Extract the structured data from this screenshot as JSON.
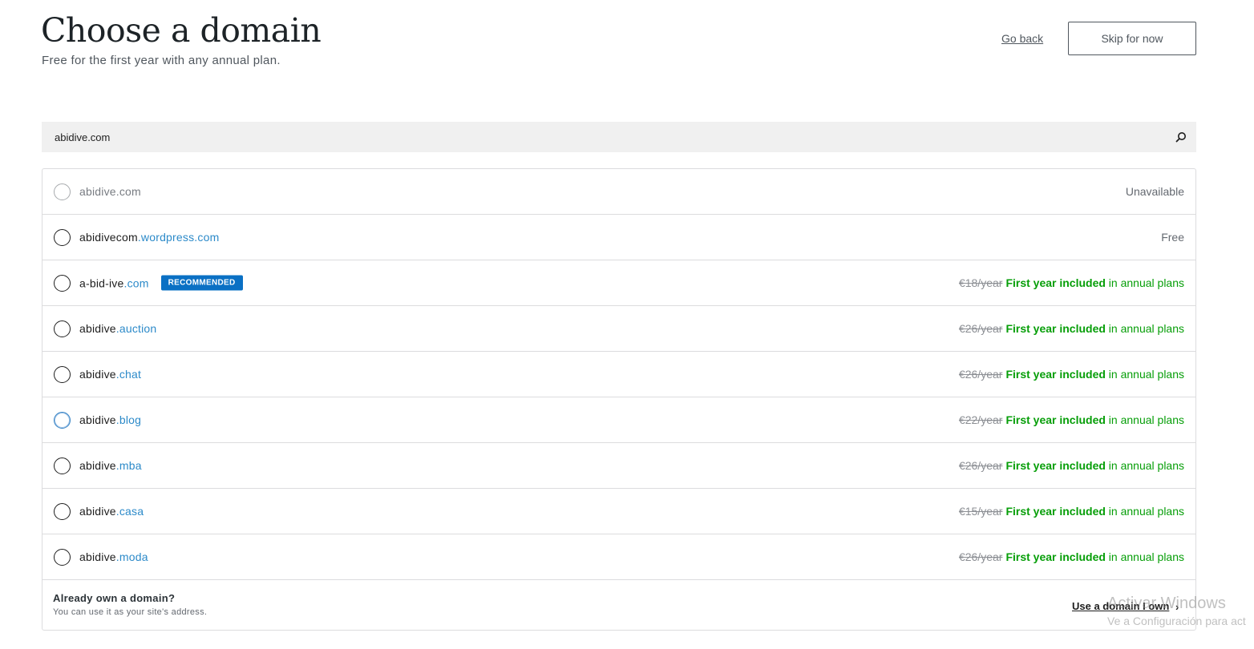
{
  "header": {
    "title": "Choose a domain",
    "subtitle": "Free for the first year with any annual plan.",
    "go_back_label": "Go back",
    "skip_label": "Skip for now"
  },
  "search": {
    "value": "abidive.com",
    "icon": "search-icon"
  },
  "domains": [
    {
      "base": "abidive.com",
      "tld": "",
      "price_text": "Unavailable",
      "state": "unavailable"
    },
    {
      "base": "abidivecom",
      "tld": ".wordpress.com",
      "price_text": "Free",
      "state": "free"
    },
    {
      "base": "a-bid-ive",
      "tld": ".com",
      "badge": "RECOMMENDED",
      "old_price": "€18/year",
      "included_bold": "First year included",
      "included_rest": " in annual plans"
    },
    {
      "base": "abidive",
      "tld": ".auction",
      "old_price": "€26/year",
      "included_bold": "First year included",
      "included_rest": " in annual plans"
    },
    {
      "base": "abidive",
      "tld": ".chat",
      "old_price": "€26/year",
      "included_bold": "First year included",
      "included_rest": " in annual plans"
    },
    {
      "base": "abidive",
      "tld": ".blog",
      "old_price": "€22/year",
      "included_bold": "First year included",
      "included_rest": " in annual plans",
      "focused": true
    },
    {
      "base": "abidive",
      "tld": ".mba",
      "old_price": "€26/year",
      "included_bold": "First year included",
      "included_rest": " in annual plans"
    },
    {
      "base": "abidive",
      "tld": ".casa",
      "old_price": "€15/year",
      "included_bold": "First year included",
      "included_rest": " in annual plans"
    },
    {
      "base": "abidive",
      "tld": ".moda",
      "old_price": "€26/year",
      "included_bold": "First year included",
      "included_rest": " in annual plans"
    }
  ],
  "own_domain": {
    "title": "Already own a domain?",
    "subtitle": "You can use it as your site's address.",
    "link_label": "Use a domain I own",
    "chevron": "›"
  },
  "watermark": {
    "line1": "Activar Windows",
    "line2": "Ve a Configuración para act"
  },
  "colors": {
    "accent_blue": "#2c8ac9",
    "badge_blue": "#0a70c4",
    "included_green": "#069e08"
  }
}
